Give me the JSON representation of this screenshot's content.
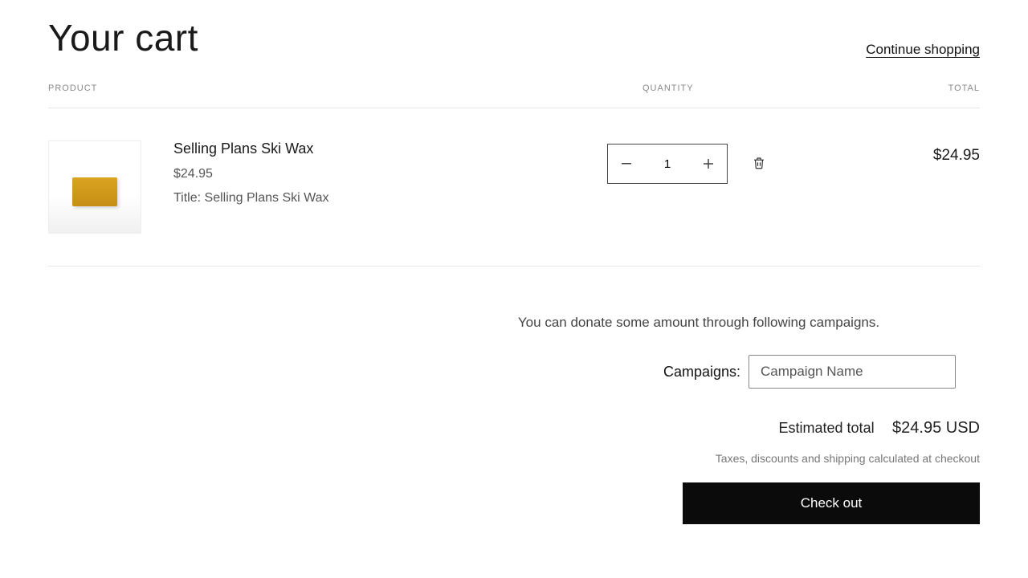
{
  "header": {
    "title": "Your cart",
    "continue": "Continue shopping"
  },
  "table": {
    "product_header": "PRODUCT",
    "quantity_header": "QUANTITY",
    "total_header": "TOTAL"
  },
  "item": {
    "name": "Selling Plans Ski Wax",
    "price": "$24.95",
    "title_line": "Title: Selling Plans Ski Wax",
    "qty": "1",
    "line_total": "$24.95"
  },
  "donate_msg": "You can donate some amount through following campaigns.",
  "campaigns": {
    "label": "Campaigns:",
    "selected": "Campaign Name"
  },
  "totals": {
    "est_label": "Estimated total",
    "est_amount": "$24.95 USD",
    "tax_note": "Taxes, discounts and shipping calculated at checkout",
    "checkout": "Check out"
  }
}
